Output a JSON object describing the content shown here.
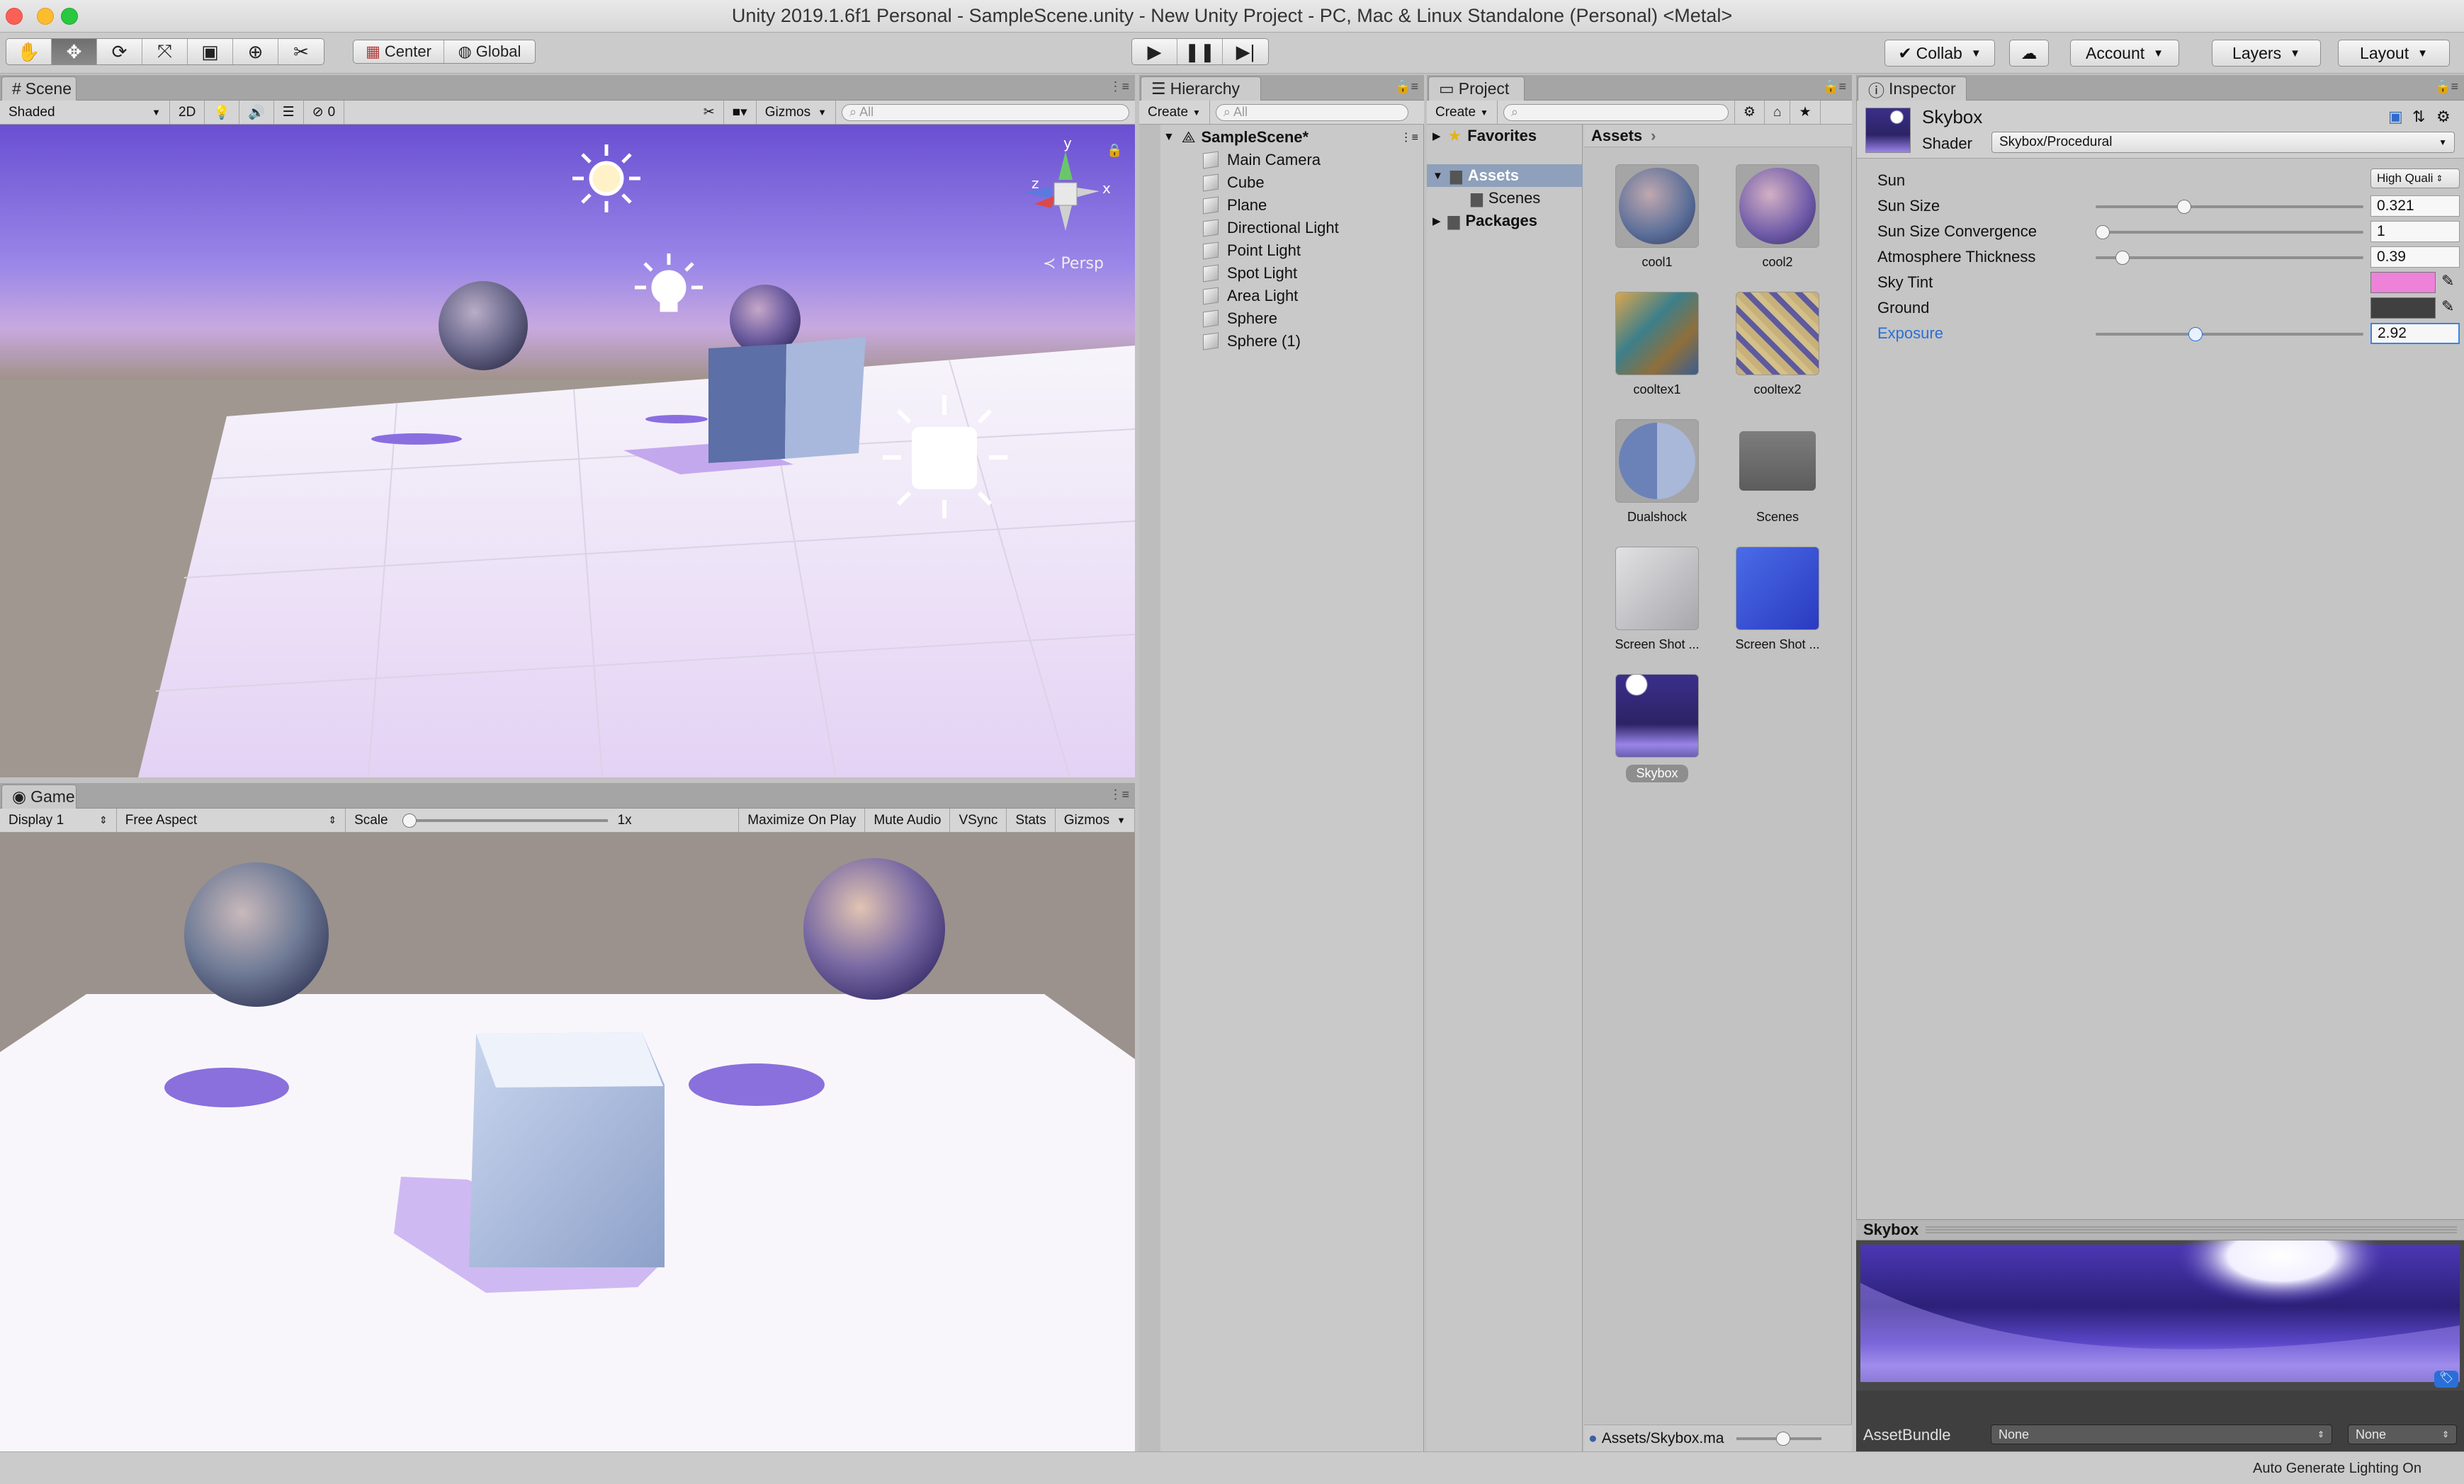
{
  "window": {
    "title": "Unity 2019.1.6f1 Personal - SampleScene.unity - New Unity Project - PC, Mac & Linux Standalone (Personal) <Metal>"
  },
  "toolbar": {
    "pivot_label": "Center",
    "space_label": "Global",
    "collab_label": "Collab",
    "account_label": "Account",
    "layers_label": "Layers",
    "layout_label": "Layout"
  },
  "scene": {
    "tab": "Scene",
    "shading": "Shaded",
    "mode_2d": "2D",
    "hidden_count": "0",
    "gizmos": "Gizmos",
    "search_placeholder": "All",
    "projection": "Persp",
    "axis_x": "x",
    "axis_y": "y",
    "axis_z": "z"
  },
  "game": {
    "tab": "Game",
    "display": "Display 1",
    "aspect": "Free Aspect",
    "scale_label": "Scale",
    "scale_value": "1x",
    "scale_fraction": 0,
    "buttons": [
      "Maximize On Play",
      "Mute Audio",
      "VSync",
      "Stats",
      "Gizmos"
    ]
  },
  "hierarchy": {
    "tab": "Hierarchy",
    "create": "Create",
    "search_placeholder": "All",
    "scene_name": "SampleScene*",
    "items": [
      "Main Camera",
      "Cube",
      "Plane",
      "Directional Light",
      "Point Light",
      "Spot Light",
      "Area Light",
      "Sphere",
      "Sphere (1)"
    ]
  },
  "project": {
    "tab": "Project",
    "create": "Create",
    "tree": {
      "favorites": "Favorites",
      "assets": "Assets",
      "scenes": "Scenes",
      "packages": "Packages"
    },
    "breadcrumb": "Assets",
    "assets": [
      "cool1",
      "cool2",
      "cooltex1",
      "cooltex2",
      "Dualshock",
      "Scenes",
      "Screen Shot ...",
      "Screen Shot ...",
      "Skybox"
    ],
    "selected_path": "Assets/Skybox.ma"
  },
  "inspector": {
    "tab": "Inspector",
    "material_name": "Skybox",
    "shader_label": "Shader",
    "shader_value": "Skybox/Procedural",
    "properties": [
      {
        "label": "Sun",
        "value": "High Quali"
      },
      {
        "label": "Sun Size",
        "value": "0.321",
        "fraction": 0.321
      },
      {
        "label": "Sun Size Convergence",
        "value": "1",
        "fraction": 0.0
      },
      {
        "label": "Atmosphere Thickness",
        "value": "0.39",
        "fraction": 0.078
      },
      {
        "label": "Sky Tint",
        "color": "#ee82d9"
      },
      {
        "label": "Ground",
        "color": "#404040"
      },
      {
        "label": "Exposure",
        "value": "2.92",
        "fraction": 0.365
      }
    ],
    "preview_title": "Skybox",
    "assetbundle_label": "AssetBundle",
    "assetbundle_value": "None",
    "assetbundle_variant": "None"
  },
  "status": {
    "text": "Auto Generate Lighting On"
  },
  "colors": {
    "accent": "#2a6fd8",
    "selection": "#3d82e6",
    "sky": "#8b6fe4"
  }
}
